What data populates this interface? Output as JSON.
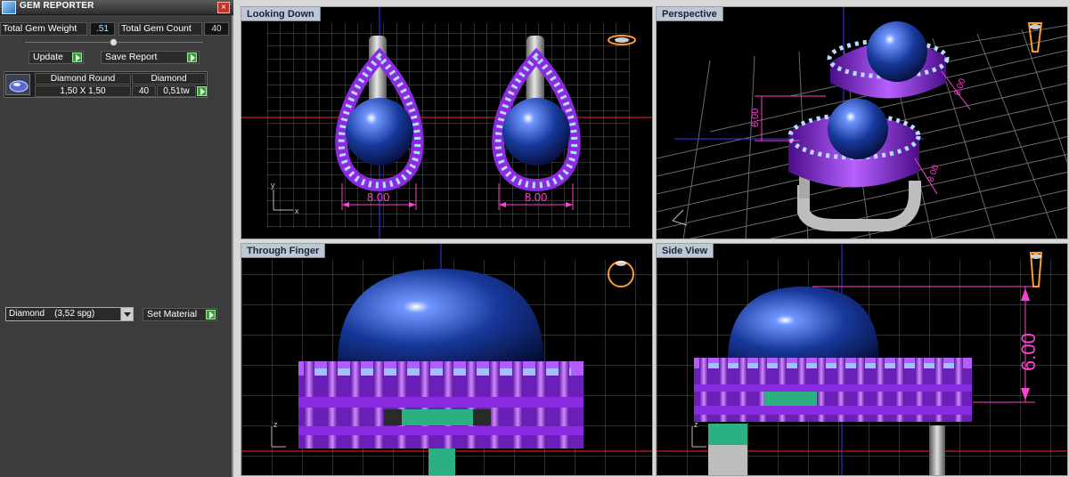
{
  "app": {
    "title": "GEM REPORTER",
    "close": "×"
  },
  "totals": {
    "weight_label": "Total Gem Weight",
    "weight_value": ".51",
    "count_label": "Total Gem Count",
    "count_value": "40"
  },
  "actions": {
    "update": "Update",
    "save_report": "Save Report"
  },
  "gem_table": {
    "col_shape": "Diamond Round",
    "col_material": "Diamond",
    "size": "1,50 X 1,50",
    "count": "40",
    "weight": "0,51tw"
  },
  "material": {
    "selected": "Diamond    (3,52 spg)",
    "set_button": "Set Material"
  },
  "viewports": {
    "top_left": {
      "label": "Looking Down",
      "dim_left": "8.00",
      "dim_right": "8.00",
      "axis_y": "y",
      "axis_x": "x"
    },
    "top_right": {
      "label": "Perspective",
      "dim_a": "6.00",
      "dim_b": "8.00",
      "dim_c": "8.00",
      "dim_d": "8.00"
    },
    "bottom_left": {
      "label": "Through Finger",
      "axis": "z"
    },
    "bottom_right": {
      "label": "Side View",
      "dim": "6.00",
      "axis": "z"
    }
  },
  "colors": {
    "metal": "#8a2be2",
    "stone": "#1a3f9a",
    "melee": "#9fd0ff",
    "dimension": "#ff40d0",
    "grid": "#6a6a6a"
  }
}
